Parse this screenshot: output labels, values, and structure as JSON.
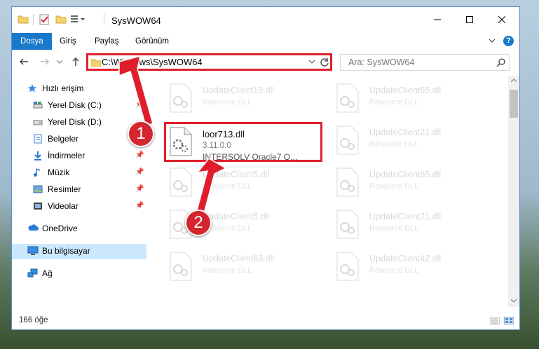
{
  "window": {
    "title": "SysWOW64",
    "ribbon_tabs": [
      "Dosya",
      "Giriş",
      "Paylaş",
      "Görünüm"
    ],
    "help_icon": "?"
  },
  "address": {
    "path": "C:\\Windows\\SysWOW64",
    "search_placeholder": "Ara: SysWOW64"
  },
  "sidebar": {
    "items": [
      {
        "label": "Hızlı erişim",
        "icon": "star-icon"
      },
      {
        "label": "Yerel Disk (C:)",
        "icon": "drive-icon"
      },
      {
        "label": "Yerel Disk (D:)",
        "icon": "drive-icon"
      },
      {
        "label": "Belgeler",
        "icon": "documents-icon"
      },
      {
        "label": "İndirmeler",
        "icon": "download-icon"
      },
      {
        "label": "Müzik",
        "icon": "music-icon"
      },
      {
        "label": "Resimler",
        "icon": "pictures-icon"
      },
      {
        "label": "Videolar",
        "icon": "videos-icon"
      },
      {
        "label": "OneDrive",
        "icon": "cloud-icon"
      },
      {
        "label": "Bu bilgisayar",
        "icon": "computer-icon"
      },
      {
        "label": "Ağ",
        "icon": "network-icon"
      }
    ]
  },
  "files": [
    {
      "name": "UpdateClient19.dll",
      "desc": "Resource DLL"
    },
    {
      "name": "UpdateClient65.dll",
      "desc": "Resource DLL"
    },
    {
      "name": "UpdateClient21.dll",
      "desc": "Resource DLL"
    },
    {
      "name": "UpdateClient5.dll",
      "desc": "Resource DLL"
    },
    {
      "name": "UpdateClient65.dll",
      "desc": "Resource DLL"
    },
    {
      "name": "UpdateClient5.dll",
      "desc": "Resource DLL"
    },
    {
      "name": "UpdateClient21.dll",
      "desc": "Resource DLL"
    },
    {
      "name": "UpdateClient63.dll",
      "desc": "Resource DLL"
    },
    {
      "name": "UpdateClient42.dll",
      "desc": "Resource DLL"
    }
  ],
  "highlighted_file": {
    "name": "loor713.dll",
    "version": "3.11.0.0",
    "description": "INTERSOLV Oracle7 O..."
  },
  "status": {
    "item_count": "166 öğe"
  },
  "badges": {
    "one": "1",
    "two": "2"
  },
  "colors": {
    "accent": "#1979ca",
    "highlight": "#e01e2b",
    "selected": "#cce8ff"
  }
}
